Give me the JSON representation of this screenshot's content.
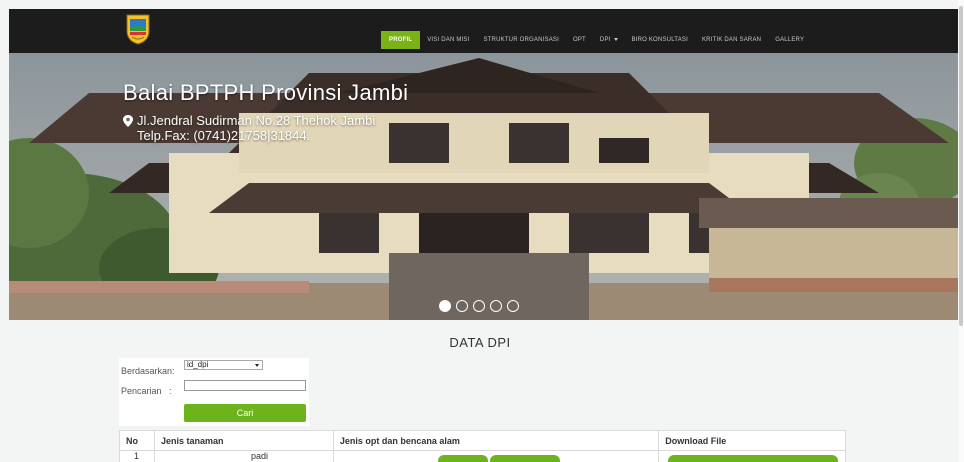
{
  "nav": {
    "items": [
      {
        "label": "PROFIL",
        "active": true
      },
      {
        "label": "VISI DAN MISI"
      },
      {
        "label": "STRUKTUR ORGANISASI"
      },
      {
        "label": "OPT"
      },
      {
        "label": "DPI",
        "dropdown": true
      },
      {
        "label": "BIRO KONSULTASI"
      },
      {
        "label": "KRITIK DAN SARAN"
      },
      {
        "label": "GALLERY"
      }
    ]
  },
  "hero": {
    "title": "Balai BPTPH Provinsi Jambi",
    "address": "Jl.Jendral Sudirman No.28 Thehok Jambi",
    "phone": "Telp.Fax: (0741)21758|31844.",
    "slide_count": 5,
    "active_slide": 1
  },
  "section": {
    "title": "DATA DPI"
  },
  "search_form": {
    "filter_label": "Berdasarkan",
    "filter_value": "id_dpi",
    "search_label": "Pencarian",
    "search_value": "",
    "submit_label": "Cari"
  },
  "table": {
    "headers": [
      "No",
      "Jenis tanaman",
      "Jenis opt dan bencana alam",
      "Download File"
    ],
    "rows": [
      {
        "no": "1",
        "jenis_tanaman": "padi"
      }
    ]
  },
  "colors": {
    "accent": "#6db31b",
    "navbar": "#1c1c1c",
    "page_bg": "#f3f4f4"
  }
}
